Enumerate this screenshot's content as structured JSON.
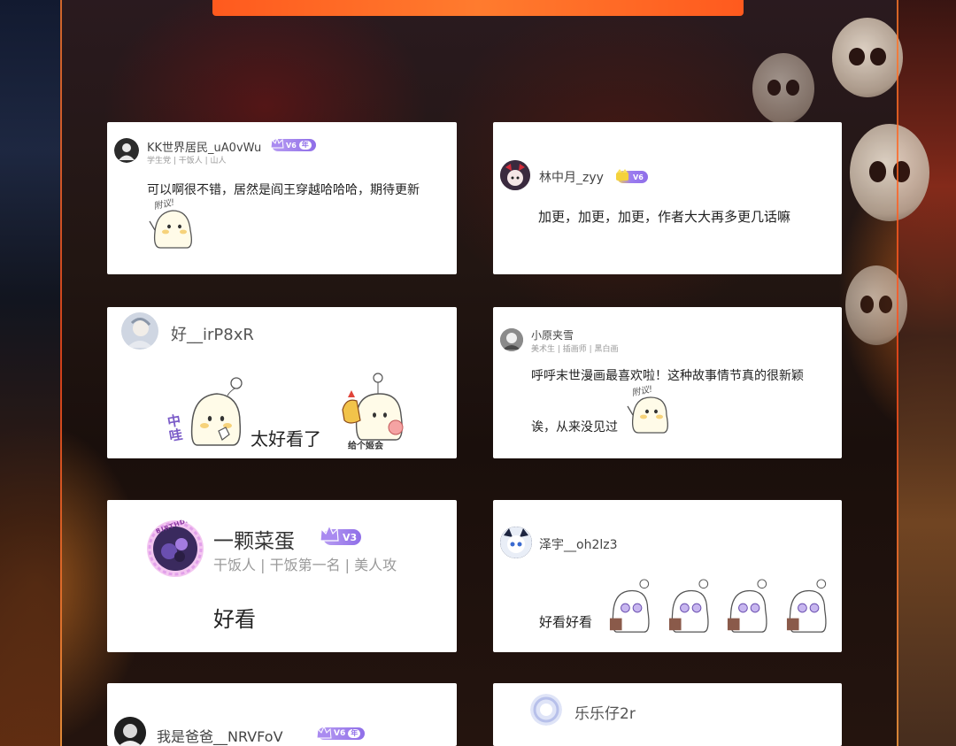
{
  "cards": [
    {
      "username": "KK世界居民_uA0vWu",
      "badge": "V6",
      "badge_suffix": "年",
      "subtitle": "学生党 | 干饭人 | 山人",
      "comment": "可以啊很不错，居然是阎王穿越哈哈哈，期待更新",
      "sticker_text": "附议!"
    },
    {
      "username": "林中月_zyy",
      "badge": "V6",
      "comment": "加更，加更，加更，作者大大再多更几话嘛"
    },
    {
      "username": "好__irP8xR",
      "sticker_left_text": "哇",
      "sticker_left_text2": "中",
      "comment": "太好看了",
      "sticker_right_text": "给个姬会"
    },
    {
      "username": "小原夹雪",
      "subtitle": "美术生 | 插画师 | 黑白画",
      "comment_line1": "呼呼末世漫画最喜欢啦！这种故事情节真的很新颖",
      "comment_line2": "诶，从来没见过",
      "sticker_text": "附议!"
    },
    {
      "username": "一颗菜蛋",
      "badge": "V3",
      "subtitle": "干饭人 | 干饭第一名 | 美人攻",
      "avatar_ring_text": "BIRTHDAY",
      "comment": "好看"
    },
    {
      "username": "泽宇__oh2lz3",
      "comment": "好看好看"
    },
    {
      "username": "我是爸爸__NRVFoV",
      "badge": "V6",
      "badge_suffix": "年"
    },
    {
      "username": "乐乐仔2r"
    }
  ],
  "colors": {
    "banner": "#ff6a24",
    "vip_badge": "#9b7cf0",
    "card_bg": "#ffffff"
  }
}
